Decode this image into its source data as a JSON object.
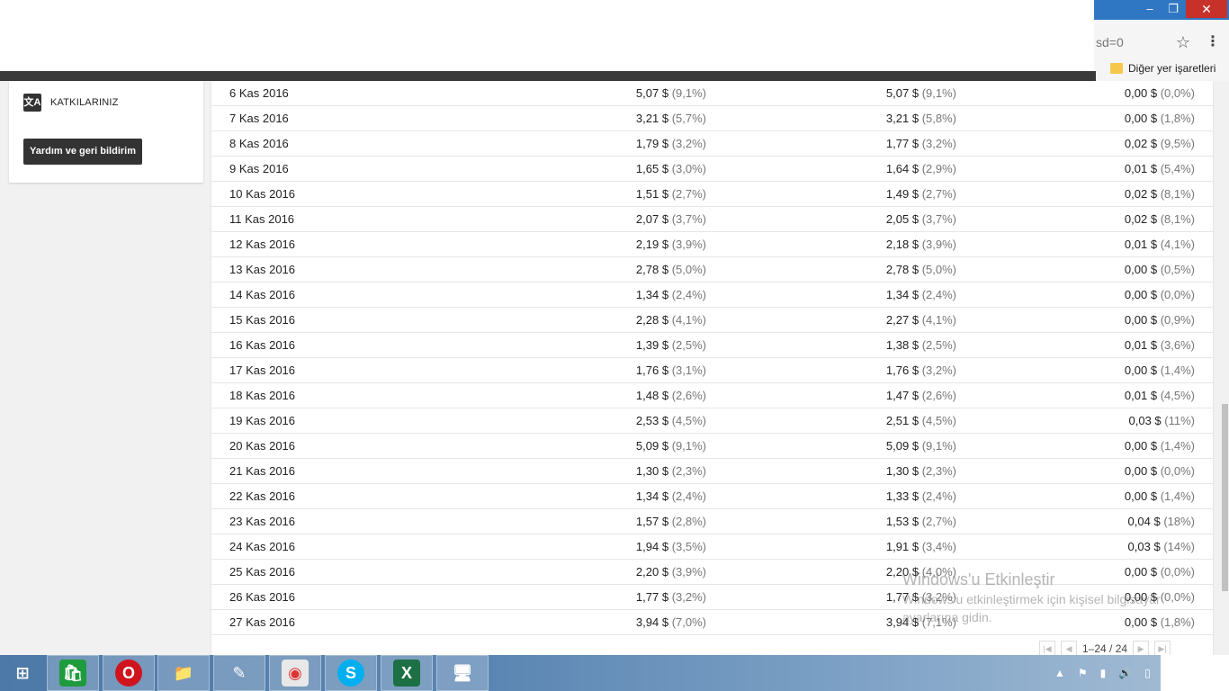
{
  "browser": {
    "address_fragment": "sd=0",
    "other_bookmarks": "Diğer yer işaretleri",
    "window_controls": {
      "minimize": "–",
      "maximize": "❐",
      "close": "✕"
    }
  },
  "sidebar": {
    "contributions_label": "KATKILARINIZ",
    "help_button": "Yardım ve geri bildirim"
  },
  "table": {
    "rows": [
      {
        "date": "6 Kas 2016",
        "a": "5,07 $",
        "a_pct": "(9,1%)",
        "b": "5,07 $",
        "b_pct": "(9,1%)",
        "c": "0,00 $",
        "c_pct": "(0,0%)"
      },
      {
        "date": "7 Kas 2016",
        "a": "3,21 $",
        "a_pct": "(5,7%)",
        "b": "3,21 $",
        "b_pct": "(5,8%)",
        "c": "0,00 $",
        "c_pct": "(1,8%)"
      },
      {
        "date": "8 Kas 2016",
        "a": "1,79 $",
        "a_pct": "(3,2%)",
        "b": "1,77 $",
        "b_pct": "(3,2%)",
        "c": "0,02 $",
        "c_pct": "(9,5%)"
      },
      {
        "date": "9 Kas 2016",
        "a": "1,65 $",
        "a_pct": "(3,0%)",
        "b": "1,64 $",
        "b_pct": "(2,9%)",
        "c": "0,01 $",
        "c_pct": "(5,4%)"
      },
      {
        "date": "10 Kas 2016",
        "a": "1,51 $",
        "a_pct": "(2,7%)",
        "b": "1,49 $",
        "b_pct": "(2,7%)",
        "c": "0,02 $",
        "c_pct": "(8,1%)"
      },
      {
        "date": "11 Kas 2016",
        "a": "2,07 $",
        "a_pct": "(3,7%)",
        "b": "2,05 $",
        "b_pct": "(3,7%)",
        "c": "0,02 $",
        "c_pct": "(8,1%)"
      },
      {
        "date": "12 Kas 2016",
        "a": "2,19 $",
        "a_pct": "(3,9%)",
        "b": "2,18 $",
        "b_pct": "(3,9%)",
        "c": "0,01 $",
        "c_pct": "(4,1%)"
      },
      {
        "date": "13 Kas 2016",
        "a": "2,78 $",
        "a_pct": "(5,0%)",
        "b": "2,78 $",
        "b_pct": "(5,0%)",
        "c": "0,00 $",
        "c_pct": "(0,5%)"
      },
      {
        "date": "14 Kas 2016",
        "a": "1,34 $",
        "a_pct": "(2,4%)",
        "b": "1,34 $",
        "b_pct": "(2,4%)",
        "c": "0,00 $",
        "c_pct": "(0,0%)"
      },
      {
        "date": "15 Kas 2016",
        "a": "2,28 $",
        "a_pct": "(4,1%)",
        "b": "2,27 $",
        "b_pct": "(4,1%)",
        "c": "0,00 $",
        "c_pct": "(0,9%)"
      },
      {
        "date": "16 Kas 2016",
        "a": "1,39 $",
        "a_pct": "(2,5%)",
        "b": "1,38 $",
        "b_pct": "(2,5%)",
        "c": "0,01 $",
        "c_pct": "(3,6%)"
      },
      {
        "date": "17 Kas 2016",
        "a": "1,76 $",
        "a_pct": "(3,1%)",
        "b": "1,76 $",
        "b_pct": "(3,2%)",
        "c": "0,00 $",
        "c_pct": "(1,4%)"
      },
      {
        "date": "18 Kas 2016",
        "a": "1,48 $",
        "a_pct": "(2,6%)",
        "b": "1,47 $",
        "b_pct": "(2,6%)",
        "c": "0,01 $",
        "c_pct": "(4,5%)"
      },
      {
        "date": "19 Kas 2016",
        "a": "2,53 $",
        "a_pct": "(4,5%)",
        "b": "2,51 $",
        "b_pct": "(4,5%)",
        "c": "0,03 $",
        "c_pct": "(11%)"
      },
      {
        "date": "20 Kas 2016",
        "a": "5,09 $",
        "a_pct": "(9,1%)",
        "b": "5,09 $",
        "b_pct": "(9,1%)",
        "c": "0,00 $",
        "c_pct": "(1,4%)"
      },
      {
        "date": "21 Kas 2016",
        "a": "1,30 $",
        "a_pct": "(2,3%)",
        "b": "1,30 $",
        "b_pct": "(2,3%)",
        "c": "0,00 $",
        "c_pct": "(0,0%)"
      },
      {
        "date": "22 Kas 2016",
        "a": "1,34 $",
        "a_pct": "(2,4%)",
        "b": "1,33 $",
        "b_pct": "(2,4%)",
        "c": "0,00 $",
        "c_pct": "(1,4%)"
      },
      {
        "date": "23 Kas 2016",
        "a": "1,57 $",
        "a_pct": "(2,8%)",
        "b": "1,53 $",
        "b_pct": "(2,7%)",
        "c": "0,04 $",
        "c_pct": "(18%)"
      },
      {
        "date": "24 Kas 2016",
        "a": "1,94 $",
        "a_pct": "(3,5%)",
        "b": "1,91 $",
        "b_pct": "(3,4%)",
        "c": "0,03 $",
        "c_pct": "(14%)"
      },
      {
        "date": "25 Kas 2016",
        "a": "2,20 $",
        "a_pct": "(3,9%)",
        "b": "2,20 $",
        "b_pct": "(4,0%)",
        "c": "0,00 $",
        "c_pct": "(0,0%)"
      },
      {
        "date": "26 Kas 2016",
        "a": "1,77 $",
        "a_pct": "(3,2%)",
        "b": "1,77 $",
        "b_pct": "(3,2%)",
        "c": "0,00 $",
        "c_pct": "(0,0%)"
      },
      {
        "date": "27 Kas 2016",
        "a": "3,94 $",
        "a_pct": "(7,0%)",
        "b": "3,94 $",
        "b_pct": "(7,1%)",
        "c": "0,00 $",
        "c_pct": "(1,8%)"
      }
    ],
    "pagination": "1–24 / 24"
  },
  "watermark": {
    "title": "Windows'u Etkinleştir",
    "subtitle": "Windows'u etkinleştirmek için kişisel bilgisayar ayarlarına gidin."
  },
  "taskbar": {
    "items": [
      {
        "name": "start-icon",
        "glyph": "⊞"
      },
      {
        "name": "store-icon",
        "glyph": "🛍"
      },
      {
        "name": "opera-icon",
        "glyph": "O"
      },
      {
        "name": "file-explorer-icon",
        "glyph": "📁"
      },
      {
        "name": "notepad-icon",
        "glyph": "✎"
      },
      {
        "name": "chrome-icon",
        "glyph": "◉"
      },
      {
        "name": "skype-icon",
        "glyph": "S"
      },
      {
        "name": "excel-icon",
        "glyph": "X"
      },
      {
        "name": "remote-desktop-icon",
        "glyph": "🖥"
      }
    ],
    "colors": {
      "store": "#1e9b3d",
      "opera": "#d0141e",
      "chrome": "#e8e8e8",
      "skype": "#00aff0",
      "excel": "#1d7044"
    }
  }
}
